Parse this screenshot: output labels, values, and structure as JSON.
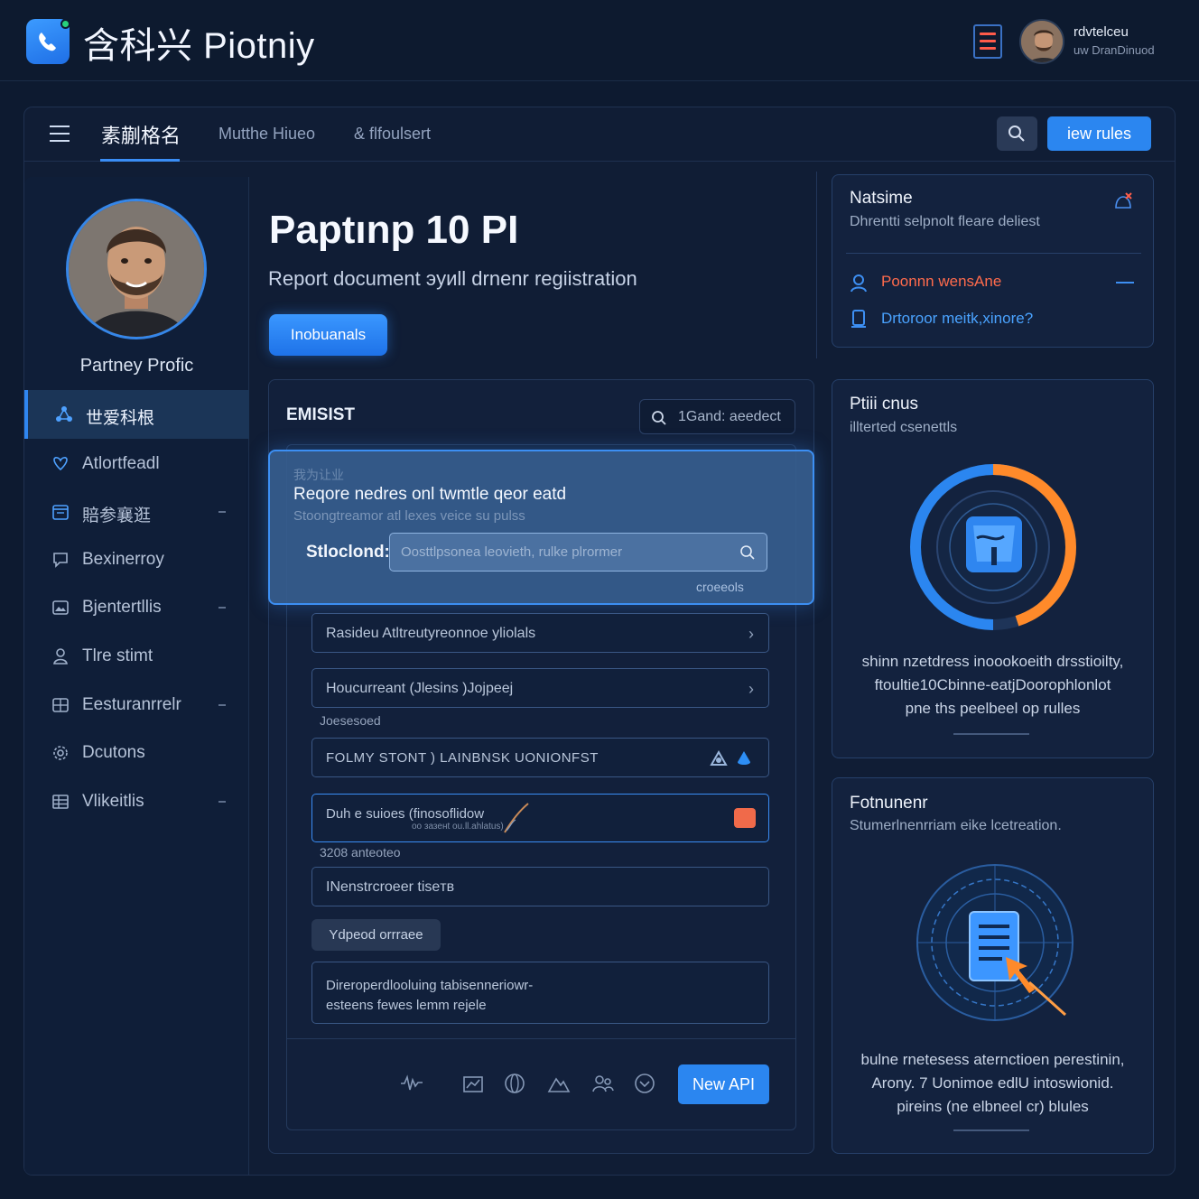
{
  "app": {
    "title": "含科兴 Piotniy",
    "user_name": "rdvtelceu",
    "user_role": "uw DranDinuod"
  },
  "tabs": {
    "active": "素蒯格名",
    "tab2": "Mutthe Hiueo",
    "tab3": "& flfoulsert",
    "new_rules": "iew rules"
  },
  "sidebar": {
    "profile_name": "Partney Profic",
    "items": [
      {
        "label": "世爱科根",
        "icon": "network-icon",
        "active": true
      },
      {
        "label": "Atlortfeadl",
        "icon": "heart-shield-icon"
      },
      {
        "label": "賠参襄逛",
        "icon": "calendar-icon",
        "dash": true
      },
      {
        "label": "Bexinerroy",
        "icon": "chat-icon"
      },
      {
        "label": "Bjentertllis",
        "icon": "image-icon",
        "dash": true
      },
      {
        "label": "Tlre stimt",
        "icon": "user-icon"
      },
      {
        "label": "Eesturanrrelr",
        "icon": "grid-icon",
        "dash": true
      },
      {
        "label": "Dcutons",
        "icon": "gear-icon"
      },
      {
        "label": "Vlikeitlis",
        "icon": "table-icon",
        "dash": true
      }
    ]
  },
  "hero": {
    "title": "Paptınp 10 PI",
    "subtitle": "Report document эуиll drnenr regiistration",
    "button": "Inobuanals"
  },
  "panel": {
    "title": "EMISIST",
    "search_placeholder": "1Gand: aeedect"
  },
  "modal": {
    "ghost_text": "我为让业",
    "title": "Reqore nedres onl twmtle qeor eatd",
    "subtitle": "Stoongtreamor atl lexes veice su pulss",
    "label": "Stloclond:",
    "input_placeholder": "Oosttlpsoneа leovieth, rulke plrormer",
    "footnote": "croeeols"
  },
  "fields": [
    {
      "text": "Rasideu Atltreutyreonnoe yliolals"
    },
    {
      "text": "Houcurreant (Jlesins )Jojpeej"
    },
    {
      "caption": "Joesesoed"
    },
    {
      "text": "FOLMY STONT ) LAINBNSK UONIONFST"
    },
    {
      "text": "Duh e suioes (finosoflidow",
      "subtext": "oо зазенt ou.ll.ahlatus)"
    },
    {
      "caption": "3208 anteoteo"
    },
    {
      "text": "INenstrcroeer tiseтв"
    },
    {
      "chip": "Ydpeod orrraee"
    },
    {
      "text": "Direroperdlooluing tabisenneriowr-",
      "text2": "esteens fewes lemm rejele"
    }
  ],
  "footer": {
    "new_api": "New API"
  },
  "notifications": {
    "title": "Natsime",
    "subtitle": "Dhrentti selpnolt fleare deliest",
    "item1": "Poonnn wensАne",
    "item2": "Drtoroor meitk,xinore?"
  },
  "card_progress": {
    "title": "Ptiii cnus",
    "subtitle": "illterted csenettls",
    "progress_fraction": 0.45,
    "desc1": "shinn nzetdress inoookoeith drsstioilty,",
    "desc2": "ftoultie10Cbinne-eatjDoorophlonlot",
    "desc3": "pne ths peelbeel op rulles"
  },
  "card_doc": {
    "title": "Fotnunenr",
    "subtitle": "Stumerlnenrriam eike lcetreation.",
    "desc1": "bulne rnetesess aternctioen perestinin,",
    "desc2": "Arony. 7 Uonimoe edlU intoswionid.",
    "desc3": "pireins (ne elbneel cr) blules"
  },
  "colors": {
    "accent": "#2b86f0",
    "background": "#0d1a30",
    "alert": "#ff6b4c",
    "progress_orange": "#ff8a2a"
  }
}
